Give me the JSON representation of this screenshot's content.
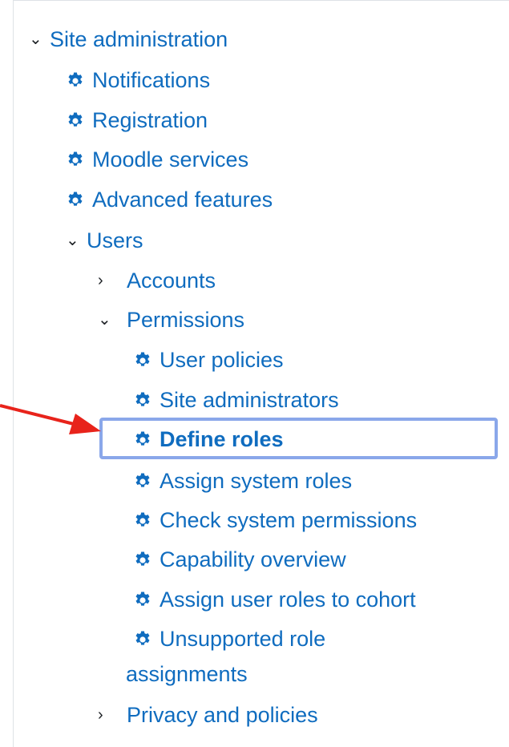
{
  "menu": {
    "site_admin": "Site administration",
    "notifications": "Notifications",
    "registration": "Registration",
    "moodle_services": "Moodle services",
    "advanced_features": "Advanced features",
    "users": "Users",
    "accounts": "Accounts",
    "permissions": "Permissions",
    "user_policies": "User policies",
    "site_administrators": "Site administrators",
    "define_roles": "Define roles",
    "assign_system_roles": "Assign system roles",
    "check_system_permissions": "Check system permissions",
    "capability_overview": "Capability overview",
    "assign_user_roles_to_cohort": "Assign user roles to cohort",
    "unsupported_role_assignments_line1": "Unsupported role",
    "unsupported_role_assignments_line2": "assignments",
    "privacy_and_policies": "Privacy and policies"
  },
  "icons": {
    "expanded": "chevron-down-icon",
    "collapsed": "chevron-right-icon",
    "setting": "gear-icon",
    "pointer": "red-arrow-icon"
  },
  "colors": {
    "link": "#0f6cbf",
    "highlight_border": "#8aa7ea",
    "arrow": "#e8231b",
    "chevron": "#1d2125"
  }
}
